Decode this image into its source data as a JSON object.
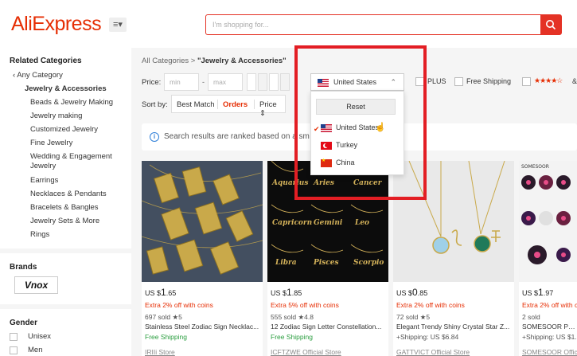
{
  "header": {
    "logo": "AliExpress",
    "menu_icon": "≡▾",
    "search_placeholder": "I'm shopping for..."
  },
  "sidebar": {
    "related_title": "Related Categories",
    "any_category": "Any Category",
    "current_category": "Jewelry & Accessories",
    "categories": [
      "Beads & Jewelry Making",
      "Jewelry making",
      "Customized Jewelry",
      "Fine Jewelry",
      "Wedding & Engagement",
      "Jewelry",
      "Earrings",
      "Necklaces & Pendants",
      "Bracelets & Bangles",
      "Jewelry Sets & More",
      "Rings"
    ],
    "brands_title": "Brands",
    "brand_logo": "Vnox",
    "gender_title": "Gender",
    "genders": [
      "Unisex",
      "Men"
    ]
  },
  "main": {
    "breadcrumb_root": "All Categories",
    "breadcrumb_sep": ">",
    "breadcrumb_current": "\"Jewelry & Accessories\"",
    "price_label": "Price:",
    "price_min_placeholder": "min",
    "price_dash": "-",
    "price_max_placeholder": "max",
    "ship_from_selected": "United States",
    "plus_label": "PLUS",
    "free_shipping_label": "Free Shipping",
    "stars": "★★★★☆",
    "stars_suffix": "&",
    "sort_label": "Sort by:",
    "sort_options": [
      "Best Match",
      "Orders",
      "Price ⇕"
    ],
    "notice_text": "Search results are ranked based on a sm"
  },
  "dropdown": {
    "reset_label": "Reset",
    "options": [
      "United States",
      "Turkey",
      "China"
    ],
    "checked_index": 0
  },
  "products": [
    {
      "currency": "US $",
      "price_int": "1",
      "price_dec": ".65",
      "discount": "Extra 2% off with coins",
      "sold": "697 sold  ★5",
      "title": "Stainless Steel Zodiac Sign Necklac...",
      "shipping": "Free Shipping",
      "store": "IRIIi Store"
    },
    {
      "currency": "US $",
      "price_int": "1",
      "price_dec": ".85",
      "discount": "Extra 5% off with coins",
      "sold": "555 sold  ★4.8",
      "title": "12 Zodiac Sign Letter Constellation...",
      "shipping": "Free Shipping",
      "store": "ICFTZWE Official Store"
    },
    {
      "currency": "US $",
      "price_int": "0",
      "price_dec": ".85",
      "discount": "Extra 2% off with coins",
      "sold": "72 sold  ★5",
      "title": "Elegant Trendy Shiny Crystal Star Z...",
      "shipping": "+Shipping: US $6.84",
      "store": "GATTVICT Official Store"
    },
    {
      "currency": "US $",
      "price_int": "1",
      "price_dec": ".97",
      "discount": "Extra 2% off with coins",
      "sold": "2 sold",
      "title": "SOMESOOR Peac",
      "shipping": "+Shipping: US $1.",
      "store": "SOMESOOR Offic"
    }
  ],
  "colors": {
    "brand": "#e62e04",
    "highlight": "#e31e24",
    "free_shipping": "#2a9e3f"
  }
}
